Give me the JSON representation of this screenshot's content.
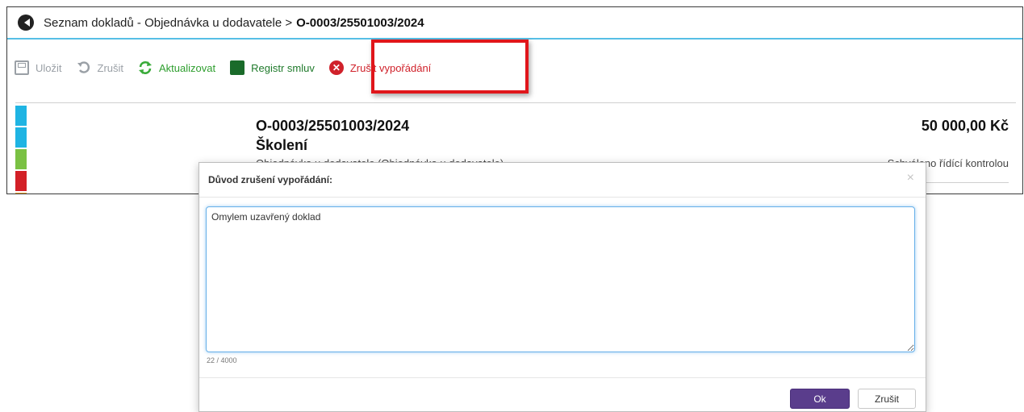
{
  "window": {
    "breadcrumb": "Seznam dokladů - Objednávka u dodavatele >",
    "document_number": "O-0003/25501003/2024"
  },
  "toolbar": {
    "save_label": "Uložit",
    "cancel_label": "Zrušit",
    "refresh_label": "Aktualizovat",
    "contracts_label": "Registr smluv",
    "cancel_settlement_label": "Zrušit vypořádání"
  },
  "document": {
    "number": "O-0003/25501003/2024",
    "name": "Školení",
    "type": "Objednávka u dodavatele (Objednávka u dodavatele)",
    "amount": "50 000,00 Kč",
    "status": "Schváleno řídící kontrolou",
    "stripe_colors": [
      "#1fb4e3",
      "#1fb4e3",
      "#7ac143",
      "#d32027",
      "#f0a030"
    ]
  },
  "dialog": {
    "title": "Důvod zrušení vypořádání:",
    "close_symbol": "×",
    "reason_value": "Omylem uzavřený doklad",
    "counter": "22 / 4000",
    "ok_label": "Ok",
    "cancel_label": "Zrušit"
  },
  "colors": {
    "accent_line": "#56bfe6",
    "ok_button": "#5a3d8c",
    "highlight": "#e0161b",
    "green": "#2e9e2e",
    "red": "#d0212a"
  }
}
